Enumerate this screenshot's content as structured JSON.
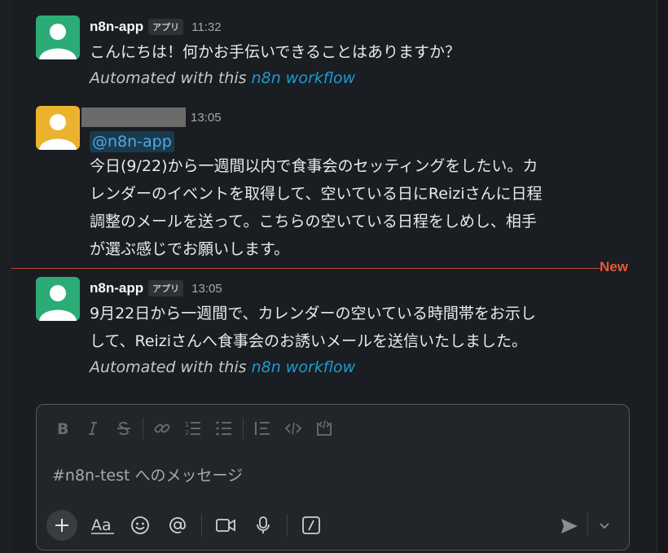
{
  "messages": [
    {
      "user": "n8n-app",
      "badge": "アプリ",
      "time": "11:32",
      "avatar_color": "#2bac76",
      "lines": [
        "こんにちは！何かお手伝いできることはありますか？"
      ],
      "footer_prefix": "Automated with this",
      "footer_link": "n8n workflow"
    },
    {
      "user": "",
      "time": "13:05",
      "avatar_color": "#ecb22e",
      "mention": "@n8n-app",
      "lines": [
        "今日(9/22)から一週間以内で食事会のセッティングをしたい。カ",
        "レンダーのイベントを取得して、空いている日にReiziさんに日程",
        "調整のメールを送って。こちらの空いている日程をしめし、相手",
        "が選ぶ感じでお願いします。"
      ]
    },
    {
      "user": "n8n-app",
      "badge": "アプリ",
      "time": "13:05",
      "avatar_color": "#2bac76",
      "lines": [
        "9月22日から一週間で、カレンダーの空いている時間帯をお示し",
        "して、Reiziさんへ食事会のお誘いメールを送信いたしました。"
      ],
      "footer_prefix": "Automated with this",
      "footer_link": "n8n workflow"
    }
  ],
  "divider": {
    "label": "New",
    "color": "#e8563a"
  },
  "composer": {
    "placeholder": "#n8n-test へのメッセージ",
    "format_icons": [
      "bold-icon",
      "italic-icon",
      "strikethrough-icon",
      "link-icon",
      "ordered-list-icon",
      "bulleted-list-icon",
      "blockquote-icon",
      "code-icon",
      "code-block-icon"
    ],
    "bottom_icons": [
      "plus-icon",
      "text-format-icon",
      "emoji-icon",
      "mention-icon",
      "video-icon",
      "microphone-icon",
      "slash-command-icon",
      "send-icon",
      "chevron-down-icon"
    ]
  },
  "colors": {
    "background": "#1a1d21",
    "link": "#1d9bd1",
    "mention_bg": "#1a3a4e"
  }
}
